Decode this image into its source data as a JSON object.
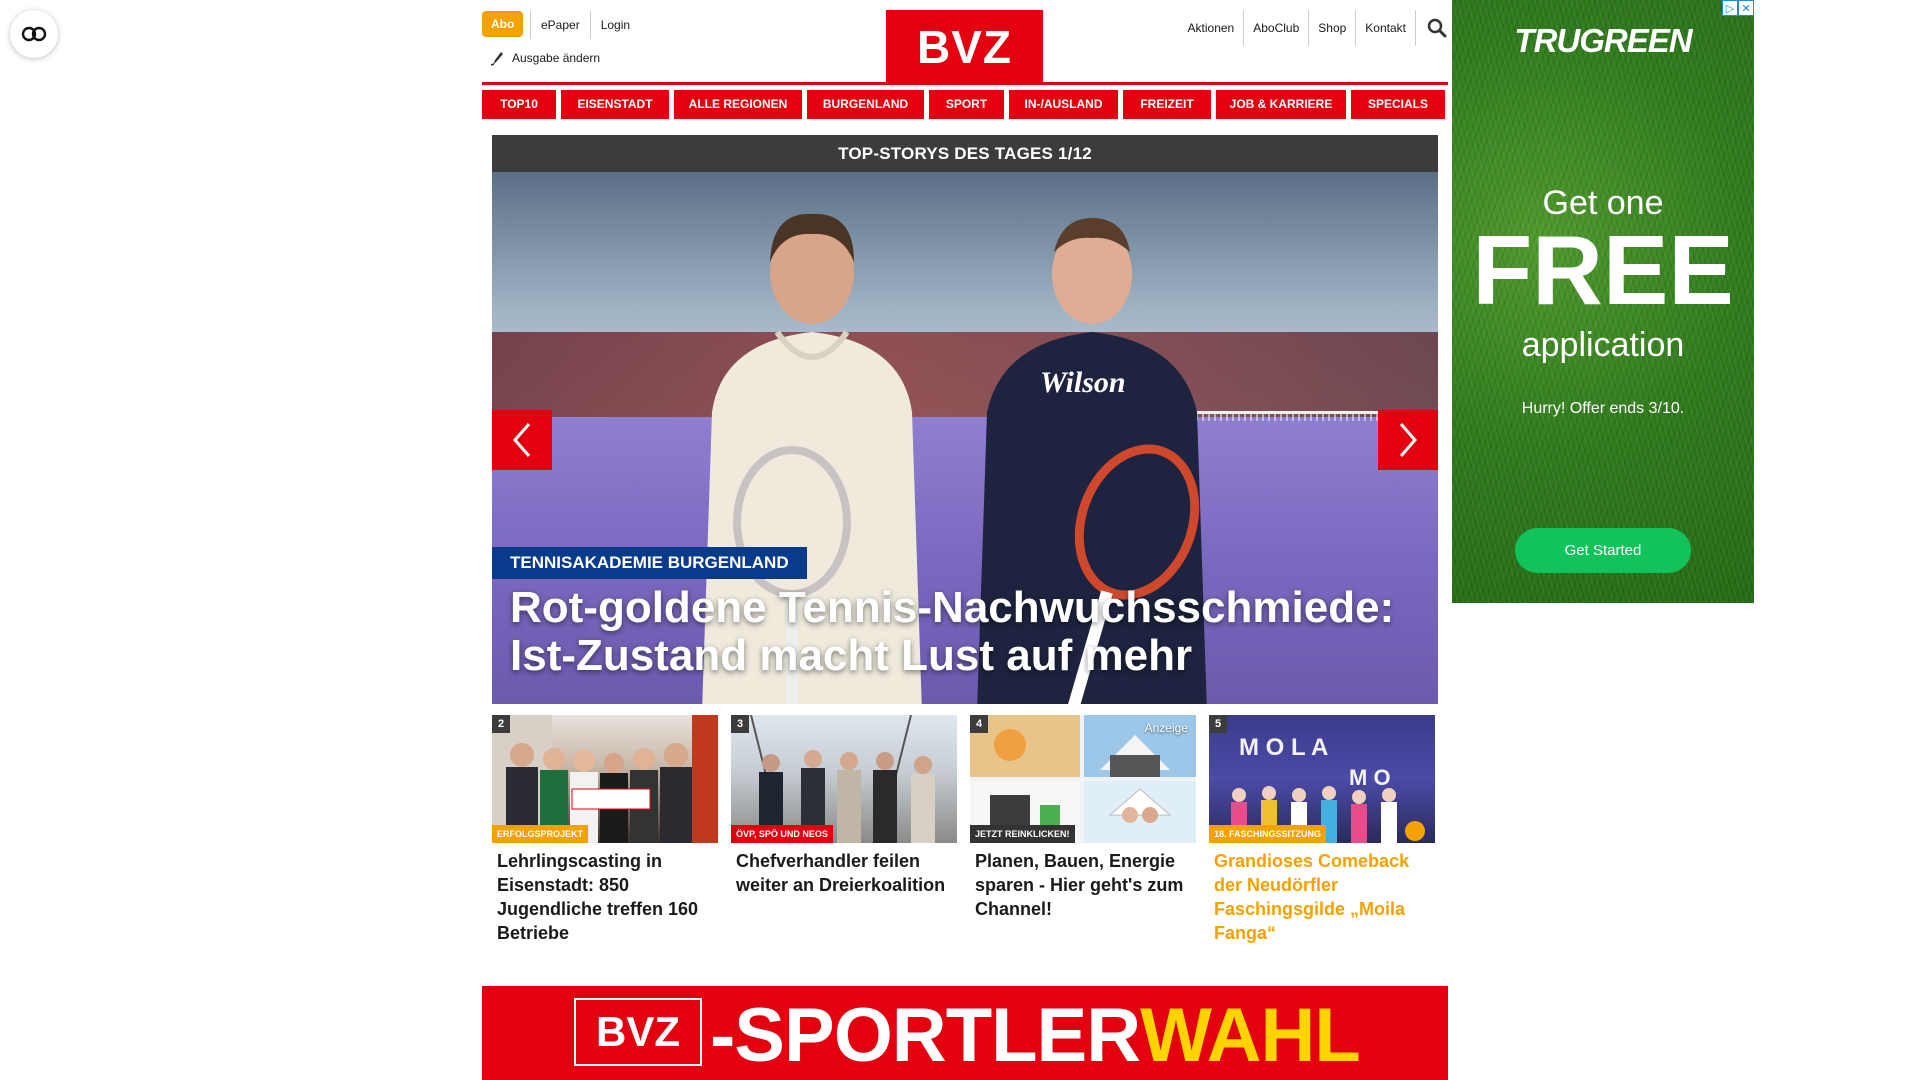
{
  "header": {
    "abo_label": "Abo",
    "top_links": [
      "ePaper",
      "Login"
    ],
    "edition_label": "Ausgabe ändern",
    "logo_text": "BVZ",
    "right_links": [
      "Aktionen",
      "AboClub",
      "Shop",
      "Kontakt"
    ]
  },
  "nav": {
    "items": [
      "TOP10",
      "EISENSTADT",
      "ALLE REGIONEN",
      "BURGENLAND",
      "SPORT",
      "IN-/AUSLAND",
      "FREIZEIT",
      "JOB & KARRIERE",
      "SPECIALS"
    ]
  },
  "topstories": {
    "heading": "TOP-STORYS DES TAGES 1/12",
    "hero": {
      "tag": "TENNISAKADEMIE BURGENLAND",
      "title": "Rot-goldene Tennis-Nachwuchsschmiede: Ist-Zustand macht Lust auf mehr"
    },
    "teasers": [
      {
        "num": "2",
        "tag": "ERFOLGSPROJEKT",
        "title": "Lehrlingscasting in Eisenstadt: 850 Jugendliche treffen 160 Betriebe"
      },
      {
        "num": "3",
        "tag": "ÖVP, SPÖ UND NEOS",
        "title": "Chefverhandler feilen weiter an Dreierkoalition"
      },
      {
        "num": "4",
        "tag": "JETZT REINKLICKEN!",
        "anzeige": "Anzeige",
        "title": "Planen, Bauen, Energie sparen - Hier geht's zum Channel!"
      },
      {
        "num": "5",
        "tag": "18. FASCHINGSSITZUNG",
        "title": "Grandioses Comeback der Neudörfler Faschingsgilde „Moila Fanga“"
      }
    ]
  },
  "banner": {
    "logo_text": "BVZ",
    "text_white": "-SPORTLER",
    "text_yellow": "WAHL"
  },
  "ad": {
    "brand": "TRUGREEN",
    "line1": "Get one",
    "line2": "FREE",
    "line3": "application",
    "offer": "Hurry! Offer ends 3/10.",
    "cta": "Get Started"
  }
}
